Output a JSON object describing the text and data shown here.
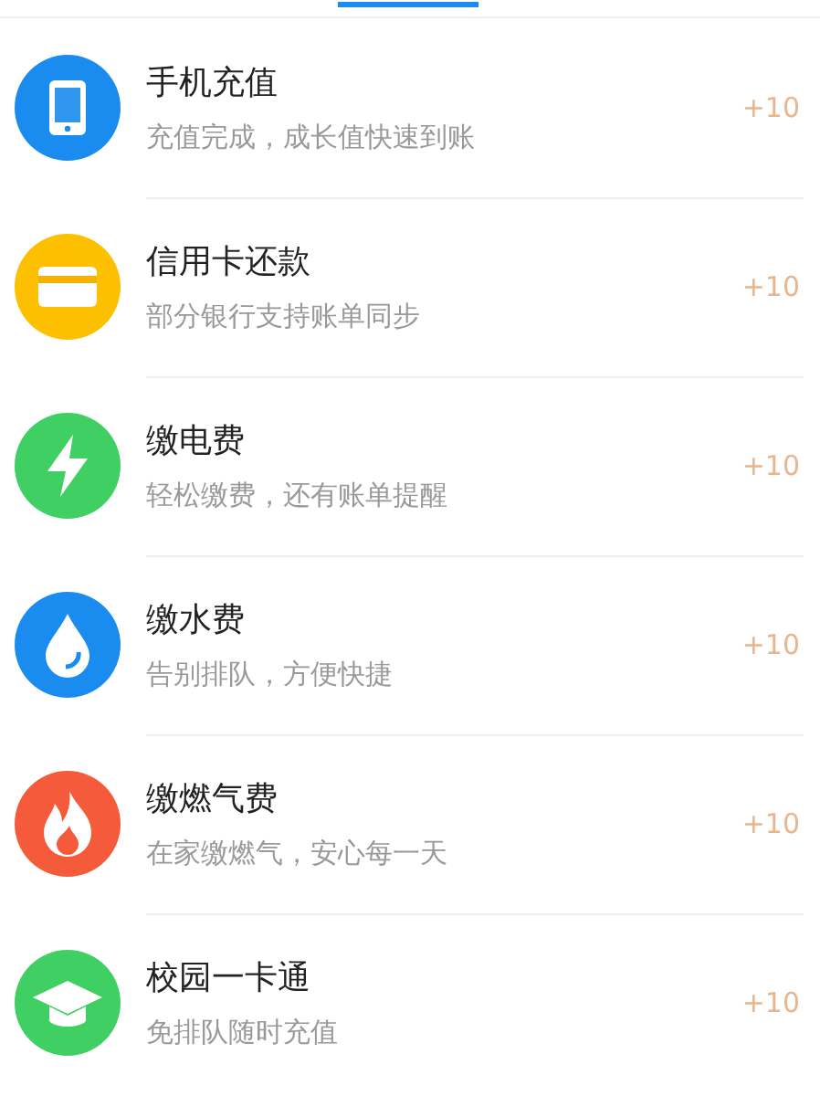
{
  "services": [
    {
      "title": "手机充值",
      "subtitle": "充值完成，成长值快速到账",
      "reward": "+10",
      "kind": "phone",
      "color": "#1a8cf0"
    },
    {
      "title": "信用卡还款",
      "subtitle": "部分银行支持账单同步",
      "reward": "+10",
      "kind": "card",
      "color": "#fcc000"
    },
    {
      "title": "缴电费",
      "subtitle": "轻松缴费，还有账单提醒",
      "reward": "+10",
      "kind": "bolt",
      "color": "#3fcf62"
    },
    {
      "title": "缴水费",
      "subtitle": "告别排队，方便快捷",
      "reward": "+10",
      "kind": "drop",
      "color": "#1a8cf0"
    },
    {
      "title": "缴燃气费",
      "subtitle": "在家缴燃气，安心每一天",
      "reward": "+10",
      "kind": "flame",
      "color": "#f55a3a"
    },
    {
      "title": "校园一卡通",
      "subtitle": "免排队随时充值",
      "reward": "+10",
      "kind": "cap",
      "color": "#3fcf62"
    }
  ]
}
